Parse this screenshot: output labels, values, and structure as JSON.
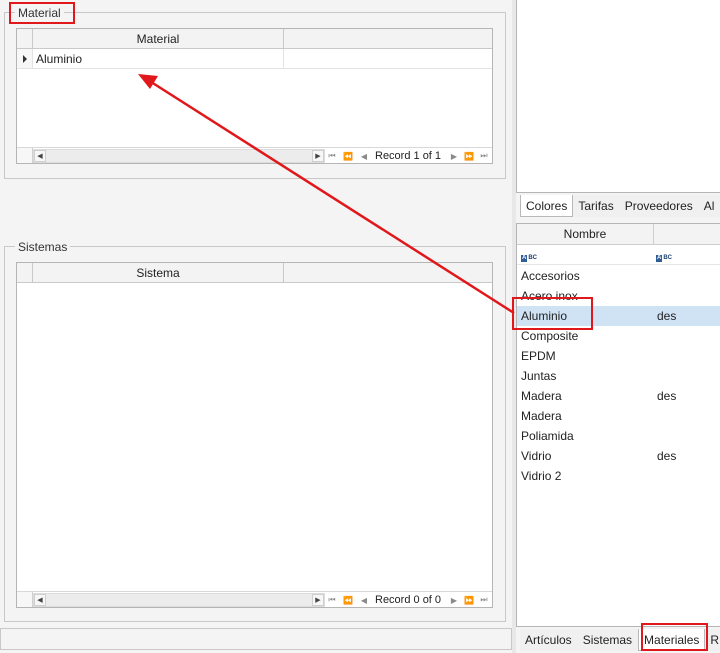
{
  "material_group": {
    "legend": "Material",
    "grid": {
      "columns": [
        "Material",
        ""
      ],
      "rows": [
        [
          "Aluminio",
          ""
        ]
      ],
      "record_text": "Record 1 of 1"
    }
  },
  "sistemas_group": {
    "legend": "Sistemas",
    "grid": {
      "columns": [
        "Sistema",
        ""
      ],
      "rows": [],
      "record_text": "Record 0 of 0"
    }
  },
  "top_right_tabs": [
    "Colores",
    "Tarifas",
    "Proveedores",
    "Al"
  ],
  "materials_list": {
    "columns": [
      "Nombre",
      ""
    ],
    "filter_icons": [
      "abc-filter-icon",
      "abc-filter-icon"
    ],
    "rows": [
      {
        "name": "Accesorios",
        "desc": ""
      },
      {
        "name": "Acero inox",
        "desc": ""
      },
      {
        "name": "Aluminio",
        "desc": "des"
      },
      {
        "name": "Composite",
        "desc": ""
      },
      {
        "name": "EPDM",
        "desc": ""
      },
      {
        "name": "Juntas",
        "desc": ""
      },
      {
        "name": "Madera",
        "desc": "des"
      },
      {
        "name": "Madera",
        "desc": ""
      },
      {
        "name": "Poliamida",
        "desc": ""
      },
      {
        "name": "Vidrio",
        "desc": "des"
      },
      {
        "name": "Vidrio 2",
        "desc": ""
      }
    ],
    "selected_index": 2
  },
  "bottom_right_tabs": [
    "Artículos",
    "Sistemas",
    "Materiales",
    "R"
  ],
  "icons": {
    "row_indicator": "row-indicator-icon",
    "scroll_left": "chevron-left-icon",
    "scroll_right": "chevron-right-icon",
    "nav_first": "first-record-icon",
    "nav_prev_page": "prev-page-icon",
    "nav_prev": "prev-record-icon",
    "nav_next": "next-record-icon",
    "nav_next_page": "next-page-icon",
    "nav_last": "last-record-icon"
  },
  "colors": {
    "annotation_red": "#e0181b",
    "selection_blue": "#cfe3f4"
  }
}
